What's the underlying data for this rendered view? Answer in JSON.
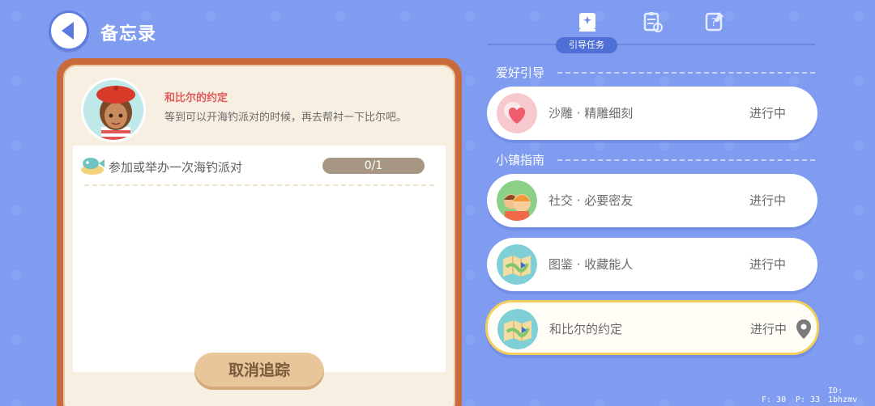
{
  "header": {
    "title": "备忘录"
  },
  "left_card": {
    "npc_name": "和比尔的约定",
    "description": "等到可以开海钓派对的时候，再去帮衬一下比尔吧。",
    "task": {
      "text": "参加或举办一次海钓派对",
      "progress_label": "0/1",
      "progress_value": 0
    },
    "cancel_label": "取消追踪"
  },
  "tabs": {
    "active_label": "引导任务",
    "icons": [
      "guide-book-icon",
      "clipboard-icon",
      "notebook-question-icon"
    ]
  },
  "sections": [
    {
      "title": "爱好引导"
    },
    {
      "title": "小镇指南"
    }
  ],
  "quests": [
    {
      "name": "沙雕 · 精雕细刻",
      "status": "进行中",
      "icon": "heart-bubble-icon"
    },
    {
      "name": "社交 · 必要密友",
      "status": "进行中",
      "icon": "friends-icon"
    },
    {
      "name": "图鉴 · 收藏能人",
      "status": "进行中",
      "icon": "map-icon"
    },
    {
      "name": "和比尔的约定",
      "status": "进行中",
      "icon": "map-icon",
      "tracked": true
    }
  ],
  "debug": {
    "f": "F: 30",
    "p": "P: 33",
    "id": "ID: 1bhzmv"
  },
  "colors": {
    "background": "#7f9cf0",
    "frame": "#c96a3a",
    "highlight": "#f2cf5b"
  }
}
